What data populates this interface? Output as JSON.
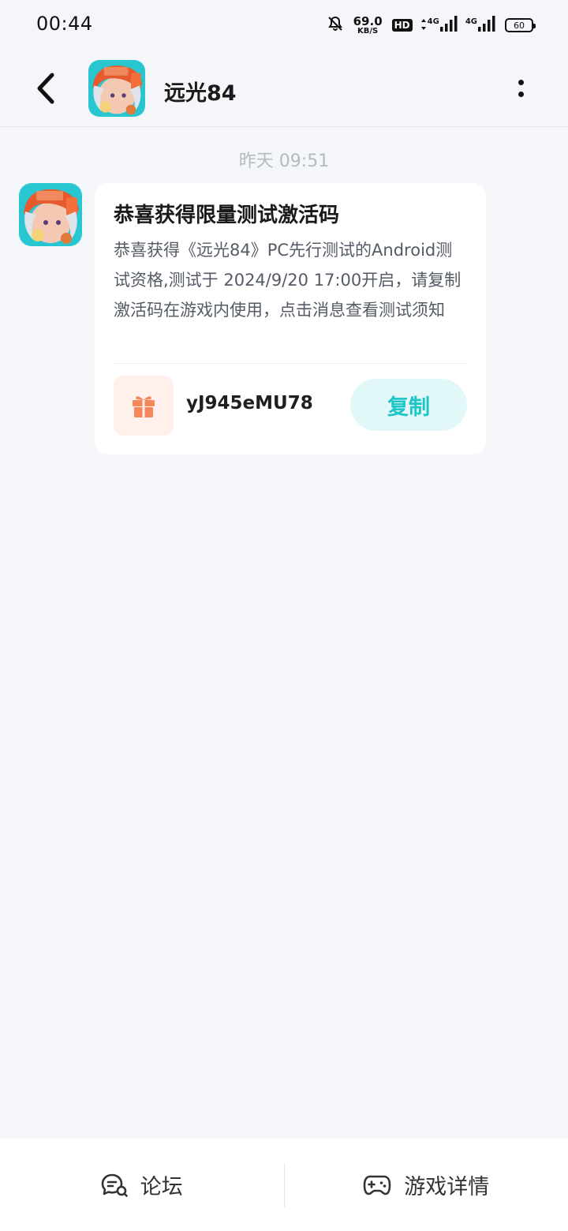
{
  "status_bar": {
    "time": "00:44",
    "net_speed_value": "69.0",
    "net_speed_unit": "KB/S",
    "hd_badge": "HD",
    "signal1_label": "4G",
    "signal2_label": "4G",
    "battery": "60"
  },
  "header": {
    "title": "远光84"
  },
  "chat": {
    "timestamp": "昨天  09:51",
    "message": {
      "title": "恭喜获得限量测试激活码",
      "body": "恭喜获得《远光84》PC先行测试的Android测试资格,测试于 2024/9/20 17:00开启，请复制激活码在游戏内使用，点击消息查看测试须知",
      "code": "yJ945eMU78",
      "copy_label": "复制"
    }
  },
  "bottom_bar": {
    "forum_label": "论坛",
    "game_details_label": "游戏详情"
  },
  "colors": {
    "accent": "#1ec6c6",
    "gift_icon": "#f5875a",
    "background": "#f4f6f9"
  }
}
